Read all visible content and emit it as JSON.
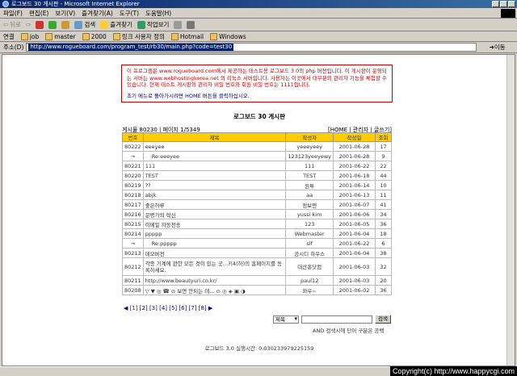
{
  "window": {
    "title": "로그보드 30 게시판 - Microsoft Internet Explorer"
  },
  "menu": [
    "파일(F)",
    "편집(E)",
    "보기(V)",
    "즐겨찾기(A)",
    "도구(T)",
    "도움말(H)"
  ],
  "toolbar": {
    "back": "뒤로",
    "search": "검색",
    "favorites": "즐겨찾기",
    "history": "작업보기"
  },
  "links": {
    "label": "연결",
    "items": [
      "job",
      "master",
      "2000",
      "링크 사용자 정의",
      "Hotmail",
      "Windows"
    ]
  },
  "address": {
    "label": "주소(D)",
    "url": "http://www.rogueboard.com/program_test/rb30/main.php?code=test30",
    "go": "이동"
  },
  "notice": {
    "text": "이 프로그램은 www.rogueboard.com에서 제공하는 테스트용 로그보드 3.0의 php 버전입니다. 이 게시판이 운영되는 서버는 www.webhostingkorea.net 의 리눅스 서버입니다. 사용자는 이곳에서 대부분의 관리자 기능을 체험할 수 있습니다. 현재 테스트 게시판의 관리자 비밀 번호와 회원 비밀 번호는 1111입니다.",
    "back": "초기 메뉴로 돌아가시려면 HOME 버튼을 클릭하십시오."
  },
  "board": {
    "title": "로그보드 30 게시판",
    "meta_left": "게시물 80230 | 페이지 1/5349",
    "meta_right": "[HOME | 관리자 | 글쓰기]",
    "headers": [
      "번호",
      "제목",
      "작성자",
      "작성일",
      "조회"
    ],
    "rows": [
      {
        "no": "80222",
        "title": "eeeyee",
        "author": "yeeeyeey",
        "date": "2001-06-28",
        "views": "17"
      },
      {
        "no": "→",
        "title": "Re:eeeyee",
        "author": "123123yeeyewy",
        "date": "2001-06-28",
        "views": "9"
      },
      {
        "no": "80221",
        "title": "111",
        "author": "111",
        "date": "2001-06-22",
        "views": "22"
      },
      {
        "no": "80220",
        "title": "TEST",
        "author": "TEST",
        "date": "2001-06-18",
        "views": "44"
      },
      {
        "no": "80219",
        "title": "??",
        "author": "원투",
        "date": "2001-06-14",
        "views": "10"
      },
      {
        "no": "80218",
        "title": "abjk",
        "author": "aa",
        "date": "2001-06-13",
        "views": "11"
      },
      {
        "no": "80217",
        "title": "좋은하루",
        "author": "정보맨",
        "date": "2001-06-07",
        "views": "41"
      },
      {
        "no": "80216",
        "title": "문명가의 혁신",
        "author": "yussi kim",
        "date": "2001-06-06",
        "views": "34"
      },
      {
        "no": "80215",
        "title": "이메일 자동전송",
        "author": "123",
        "date": "2001-06-05",
        "views": "36"
      },
      {
        "no": "80214",
        "title": "ppppp",
        "author": "Webmaster",
        "date": "2001-06-04",
        "views": "18"
      },
      {
        "no": "→",
        "title": "Re:ppppp",
        "author": "slf",
        "date": "2001-06-22",
        "views": "6"
      },
      {
        "no": "80213",
        "title": "데모버전",
        "author": "공시디 하우스",
        "date": "2001-06-04",
        "views": "38"
      },
      {
        "no": "80212",
        "title": "각종 기계에 관한 모든 것이 있는 곳...키4(하)의 홈페이지를 동록하세요.",
        "author": "대산홍닷컴",
        "date": "2001-06-03",
        "views": "32",
        "tall": true
      },
      {
        "no": "80211",
        "title": "http://www.beautyuri.co.kr/",
        "author": "paul12",
        "date": "2001-06-03",
        "views": "20"
      },
      {
        "no": "80208",
        "title": "▽ ▼ ◎ ☎ ⊙ 보면 만되는 데... ⊙ ◎ ◈ ▣ ◑",
        "author": "와우~",
        "date": "2001-06-02",
        "views": "36"
      }
    ]
  },
  "pager": {
    "prev": "◀",
    "current": "[1]",
    "pages": [
      "[2]",
      "[3]",
      "[4]",
      "[5]",
      "[6]",
      "[7]",
      "[8]"
    ],
    "next": "▶"
  },
  "search": {
    "select": "제목",
    "button": "검색",
    "hint": "AND 검색시에 단어 구분은 공백"
  },
  "runtime": "로그보드 3.0 실행시간: 0.030233979225159",
  "watermark": "Copyright(c) http://www.happycgi.com"
}
